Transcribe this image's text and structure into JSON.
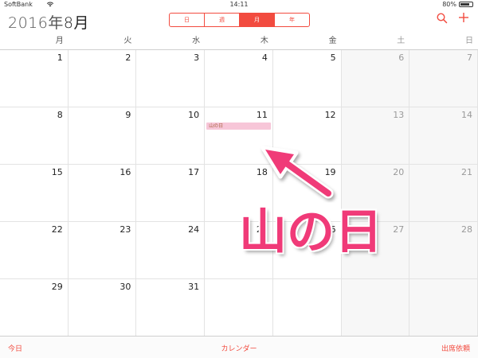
{
  "status": {
    "carrier": "SoftBank",
    "time": "14:11",
    "battery": "80%",
    "battery_level": 0.8
  },
  "header": {
    "year": "2016年",
    "month": "8月",
    "segments": [
      {
        "label": "日",
        "active": false
      },
      {
        "label": "週",
        "active": false
      },
      {
        "label": "月",
        "active": true
      },
      {
        "label": "年",
        "active": false
      }
    ],
    "search_icon": "search-icon",
    "add_icon": "plus-icon"
  },
  "weekdays": [
    "月",
    "火",
    "水",
    "木",
    "金",
    "土",
    "日"
  ],
  "days": [
    "1",
    "2",
    "3",
    "4",
    "5",
    "6",
    "7",
    "8",
    "9",
    "10",
    "11",
    "12",
    "13",
    "14",
    "15",
    "16",
    "17",
    "18",
    "19",
    "20",
    "21",
    "22",
    "23",
    "24",
    "25",
    "26",
    "27",
    "28",
    "29",
    "30",
    "31",
    "",
    "",
    "",
    ""
  ],
  "event": {
    "day": "11",
    "title": "山の日"
  },
  "annotation": "山の日",
  "tabbar": {
    "today": "今日",
    "calendars": "カレンダー",
    "inbox": "出席依頼"
  },
  "colors": {
    "accent": "#f24b3f",
    "annotation": "#f03a78",
    "event": "#f7c6d8"
  }
}
